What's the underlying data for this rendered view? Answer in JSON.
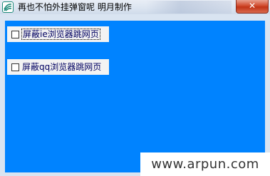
{
  "window": {
    "title": "再也不怕外挂弹窗呢  明月制作",
    "close_label": "✕"
  },
  "options": [
    {
      "label": "屏蔽ie浏览器跳网页",
      "checked": false,
      "focused": true
    },
    {
      "label": "屏蔽qq浏览器跳网页",
      "checked": false,
      "focused": false
    }
  ],
  "watermark": "www.arpun.com",
  "colors": {
    "client_bg": "#0083ff",
    "close_button": "#c23517"
  }
}
